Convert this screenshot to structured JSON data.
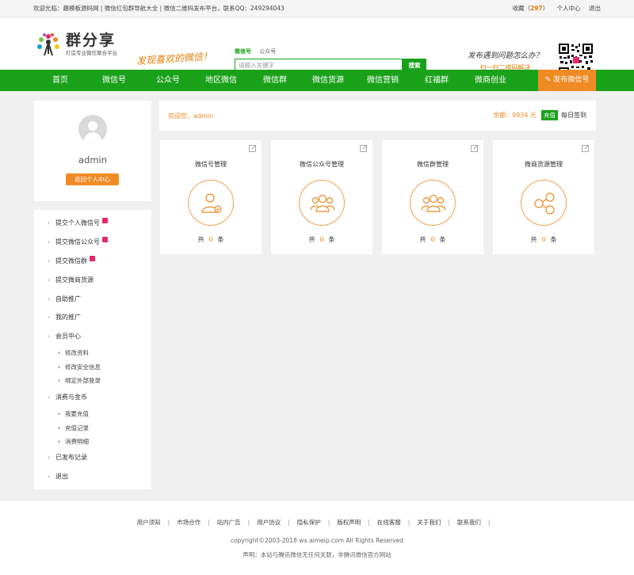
{
  "topbar": {
    "left_text": "欢迎光临：趣模板源码网 | 微信红包群导航大全 | 微信二维码发布平台，联系QQ：249294043",
    "fav_label": "收藏",
    "fav_open": "（",
    "fav_count": "297",
    "fav_close": "）",
    "user_center": "个人中心",
    "logout": "退出"
  },
  "header": {
    "logo_title": "群分享",
    "logo_sub": "打造专业微信聚合平台",
    "slogan": "发现喜欢的微信！",
    "search_tab_active": "微信号",
    "search_tab_other": "公众号",
    "search_placeholder": "请输入关键字",
    "search_button": "搜索",
    "help_question": "发布遇到问题怎么办？",
    "help_tip": "扫一扫二维码解决"
  },
  "nav": {
    "items": [
      "首页",
      "微信号",
      "公众号",
      "地区微信",
      "微信群",
      "微信货源",
      "微信营销",
      "红福群",
      "微商创业"
    ],
    "publish": "发布微信号"
  },
  "profile": {
    "username": "admin",
    "back_button": "返回个人中心"
  },
  "menu": {
    "items": [
      "提交个人微信号",
      "提交微信公众号",
      "提交微信群",
      "提交微商货源",
      "自助推广",
      "我的推广",
      "会员中心",
      "消费与金币",
      "已发布记录",
      "退出"
    ],
    "member_sub": [
      "修改资料",
      "修改安全信息",
      "绑定外部登录"
    ],
    "coin_sub": [
      "我要充值",
      "充值记录",
      "消费明细"
    ]
  },
  "welcome": {
    "greeting": "欢迎您，admin",
    "balance": "余额：9934 元",
    "recharge": "充值",
    "signin": "每日签到"
  },
  "cards": [
    {
      "title": "微信号管理",
      "prefix": "共",
      "count": "0",
      "suffix": "条",
      "icon": "user-check-icon"
    },
    {
      "title": "微信公众号管理",
      "prefix": "共",
      "count": "0",
      "suffix": "条",
      "icon": "group-icon"
    },
    {
      "title": "微信群管理",
      "prefix": "共",
      "count": "0",
      "suffix": "条",
      "icon": "group-icon"
    },
    {
      "title": "微商货源管理",
      "prefix": "共",
      "count": "0",
      "suffix": "条",
      "icon": "share-nodes-icon"
    }
  ],
  "footer": {
    "links": [
      "用户须知",
      "市场合作",
      "站内广告",
      "用户协议",
      "隐私保护",
      "版权声明",
      "在线客服",
      "关于我们",
      "联系我们"
    ],
    "copyright": "copyright©2003-2018 wx.aimeip.com All Rights Reserved",
    "declaration": "声明：本站与腾讯微信无任何关联，非腾讯微信官方网站"
  },
  "colors": {
    "brand_green": "#1aa11a",
    "accent_orange": "#f08a24",
    "badge_pink": "#e8266c"
  }
}
